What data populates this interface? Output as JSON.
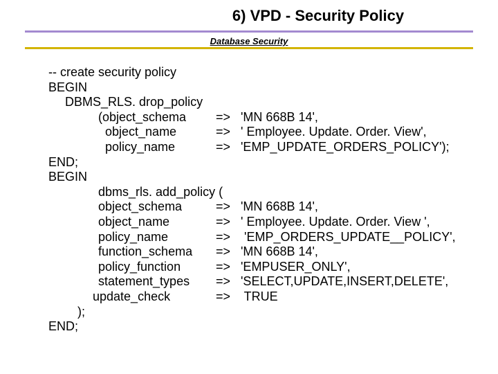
{
  "header": {
    "title": "6) VPD - Security Policy",
    "subtitle": "Database Security"
  },
  "code": {
    "l01": "-- create security policy",
    "l02": "BEGIN",
    "l03": "DBMS_RLS. drop_policy",
    "l04k": "(object_schema",
    "l04a": "=>",
    "l04v": "'MN 668B 14',",
    "l05k": "object_name",
    "l05a": "=>",
    "l05v": "' Employee. Update. Order. View',",
    "l06k": "policy_name",
    "l06a": "=>",
    "l06v": "'EMP_UPDATE_ORDERS_POLICY');",
    "l07": "END;",
    "l08": "BEGIN",
    "l09": "dbms_rls. add_policy (",
    "l10k": "object_schema",
    "l10a": "=>",
    "l10v": "'MN 668B 14',",
    "l11k": "object_name",
    "l11a": "=>",
    "l11v": "' Employee. Update. Order. View ',",
    "l12k": "policy_name",
    "l12a": "=>",
    "l12v": " 'EMP_ORDERS_UPDATE__POLICY',",
    "l13k": "function_schema",
    "l13a": "=>",
    "l13v": "'MN 668B 14',",
    "l14k": "policy_function",
    "l14a": "=>",
    "l14v": "'EMPUSER_ONLY',",
    "l15k": "statement_types",
    "l15a": "=>",
    "l15v": "'SELECT,UPDATE,INSERT,DELETE',",
    "l16k": "update_check",
    "l16a": "=>",
    "l16v": " TRUE",
    "l17": ");",
    "l18": "END;"
  }
}
